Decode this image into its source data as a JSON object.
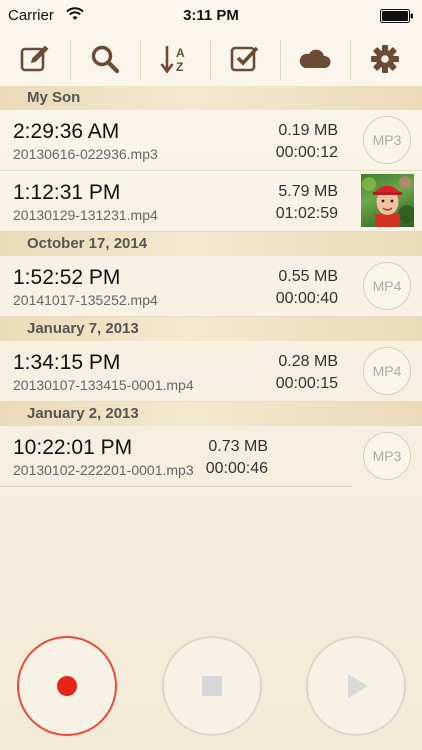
{
  "status_bar": {
    "carrier": "Carrier",
    "time": "3:11 PM"
  },
  "toolbar": {
    "icons": [
      "edit-icon",
      "search-icon",
      "sort-az-icon",
      "checkbox-icon",
      "cloud-icon",
      "gear-icon"
    ],
    "sort_letters": {
      "top": "A",
      "bottom": "Z"
    },
    "icon_color": "#6b4a36"
  },
  "sections": [
    {
      "header": "My Son",
      "rows": [
        {
          "title": "2:29:36 AM",
          "file": "20130616-022936.mp3",
          "size": "0.19 MB",
          "duration": "00:00:12",
          "badge": "MP3"
        },
        {
          "title": "1:12:31 PM",
          "file": "20130129-131231.mp4",
          "size": "5.79 MB",
          "duration": "01:02:59",
          "badge": ""
        }
      ]
    },
    {
      "header": "October 17, 2014",
      "rows": [
        {
          "title": "1:52:52 PM",
          "file": "20141017-135252.mp4",
          "size": "0.55 MB",
          "duration": "00:00:40",
          "badge": "MP4"
        }
      ]
    },
    {
      "header": "January 7, 2013",
      "rows": [
        {
          "title": "1:34:15 PM",
          "file": "20130107-133415-0001.mp4",
          "size": "0.28 MB",
          "duration": "00:00:15",
          "badge": "MP4"
        }
      ]
    },
    {
      "header": "January 2, 2013",
      "rows": [
        {
          "title": "10:22:01 PM",
          "file": "20130102-222201-0001.mp3",
          "size": "0.73 MB",
          "duration": "00:00:46",
          "badge": "MP3"
        }
      ]
    }
  ],
  "controls": {
    "record_color": "#e8231a",
    "disabled_color": "#d8d8d8"
  }
}
